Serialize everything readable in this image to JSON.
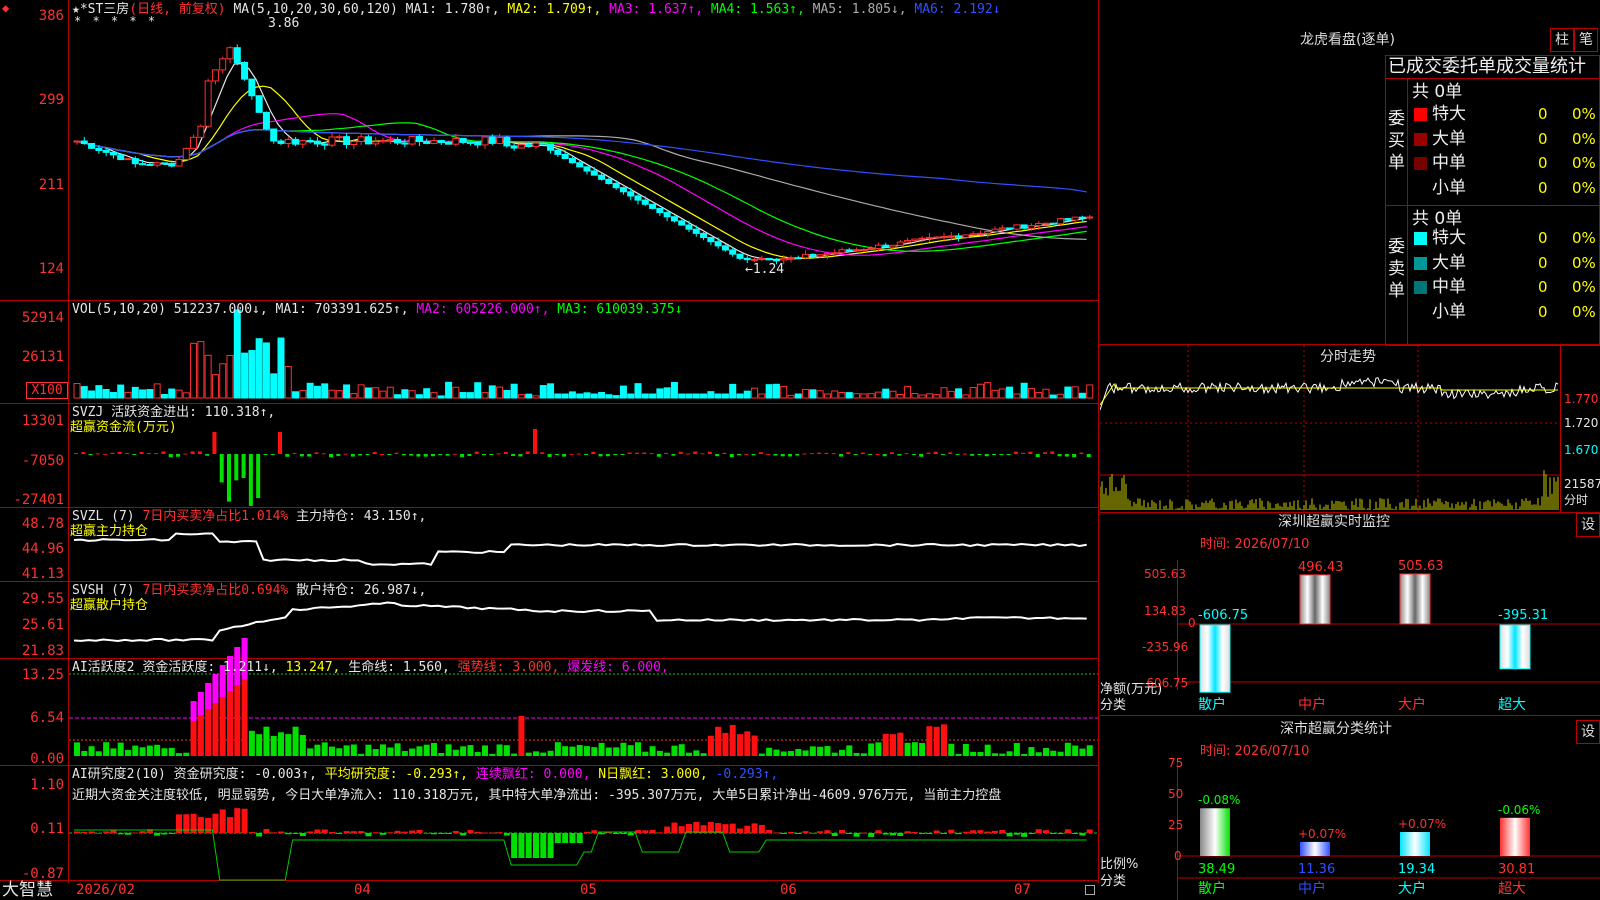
{
  "window": {
    "control_glyph": "◆"
  },
  "main": {
    "stock_name": "★*ST三房",
    "period": "(日线, 前复权)",
    "top_marks": "* *  * * *",
    "ma_header": "MA(5,10,20,30,60,120)",
    "ma": [
      {
        "label": "MA1: 1.780↑,",
        "color": "#e6e6e6"
      },
      {
        "label": "MA2: 1.709↑,",
        "color": "#ffff00"
      },
      {
        "label": "MA3: 1.637↑,",
        "color": "#ff00ff"
      },
      {
        "label": "MA4: 1.563↑,",
        "color": "#00ff00"
      },
      {
        "label": "MA5: 1.805↓,",
        "color": "#aaaaaa"
      },
      {
        "label": "MA6: 2.192↓",
        "color": "#3050ff"
      }
    ],
    "high_label": "3.86",
    "low_label": "←1.24",
    "yaxis": [
      "386",
      "299",
      "211",
      "124"
    ]
  },
  "vol": {
    "header": "VOL(5,10,20)",
    "value": "512237.000↓,",
    "ma1": "MA1: 703391.625↑,",
    "ma2": "MA2: 605226.000↑,",
    "ma3": "MA3: 610039.375↓",
    "yaxis": [
      "52914",
      "26131"
    ],
    "unit": "X100"
  },
  "svzj": {
    "header": "SVZJ",
    "line1": "活跃资金进出: 110.318↑,",
    "line2": "超赢资金流(万元)",
    "yaxis": [
      "13301",
      "-7050",
      "-27401"
    ]
  },
  "svzl": {
    "header": "SVZL (7)",
    "net": "7日内买卖净占比1.014%",
    "hold": "主力持仓: 43.150↑,",
    "line2": "超赢主力持仓",
    "yaxis": [
      "48.78",
      "44.96",
      "41.13"
    ]
  },
  "svsh": {
    "header": "SVSH (7)",
    "net": "7日内买卖净占比0.694%",
    "hold": "散户持仓: 26.987↓,",
    "line2": "超赢散户持仓",
    "yaxis": [
      "29.55",
      "25.61",
      "21.83"
    ]
  },
  "ai_active": {
    "header": "AI活跃度2",
    "v1": "资金活跃度: 1.211↓,",
    "v2": "13.247,",
    "v3": "生命线: 1.560,",
    "v4": "强势线: 3.000,",
    "v5": "爆发线: 6.000,",
    "yaxis": [
      "13.25",
      "6.54",
      "0.00"
    ]
  },
  "ai_research": {
    "header": "AI研究度2(10)",
    "v1": "资金研究度: -0.003↑,",
    "v2": "平均研究度: -0.293↑,",
    "v3": "连续飘红: 0.000,",
    "v4": "N日飘红: 3.000,",
    "v5": "-0.293↑,",
    "comment": "近期大资金关注度较低, 明显弱势, 今日大单净流入: 110.318万元, 其中特大单净流出: -395.307万元, 大单5日累计净出-4609.976万元, 当前主力控盘",
    "yaxis": [
      "1.10",
      "0.11",
      "-0.87"
    ]
  },
  "xaxis": {
    "brand": "大智慧",
    "labels": [
      "2026/02",
      "04",
      "05",
      "06",
      "07"
    ]
  },
  "dragon": {
    "title": "龙虎看盘(逐单)",
    "btn_bar": "柱",
    "btn_pen": "笔",
    "subtitle": "已成交委托单成交量统计",
    "buy_label": "委买单",
    "sell_label": "委卖单",
    "buy_total": "共 0单",
    "sell_total": "共 0单",
    "buy_rows": [
      {
        "name": "特大",
        "count": "0",
        "pct": "0%",
        "color": "#ff0000"
      },
      {
        "name": "大单",
        "count": "0",
        "pct": "0%",
        "color": "#990000"
      },
      {
        "name": "中单",
        "count": "0",
        "pct": "0%",
        "color": "#770000"
      },
      {
        "name": "小单",
        "count": "0",
        "pct": "0%",
        "color": "#000000"
      }
    ],
    "sell_rows": [
      {
        "name": "特大",
        "count": "0",
        "pct": "0%",
        "color": "#00ffff"
      },
      {
        "name": "大单",
        "count": "0",
        "pct": "0%",
        "color": "#009999"
      },
      {
        "name": "中单",
        "count": "0",
        "pct": "0%",
        "color": "#007777"
      },
      {
        "name": "小单",
        "count": "0",
        "pct": "0%",
        "color": "#000000"
      }
    ]
  },
  "intraday": {
    "title": "分时走势",
    "yaxis": [
      "1.770",
      "1.720",
      "1.670"
    ],
    "vol_label": "21587",
    "unit": "分时"
  },
  "monitor": {
    "title": "深圳超赢实时监控",
    "btn": "设",
    "time": "时间: 2026/07/10",
    "yaxis": [
      "505.63",
      "134.83",
      "0",
      "-235.96",
      "-606.75"
    ],
    "ylabel1": "净额(万元)",
    "ylabel2": "分类",
    "bars": [
      {
        "name": "散户",
        "value": -606.75,
        "label": "-606.75",
        "label_color": "#00ffff"
      },
      {
        "name": "中户",
        "value": 496.43,
        "label": "496.43",
        "label_color": "#ff3030"
      },
      {
        "name": "大户",
        "value": 505.63,
        "label": "505.63",
        "label_color": "#ff3030"
      },
      {
        "name": "超大",
        "value": -395.31,
        "label": "-395.31",
        "label_color": "#00ffff"
      }
    ]
  },
  "classify": {
    "title": "深市超赢分类统计",
    "btn": "设",
    "time": "时间: 2026/07/10",
    "yaxis": [
      "75",
      "50",
      "25",
      "0"
    ],
    "ylabel1": "比例%",
    "ylabel2": "分类",
    "bars": [
      {
        "name": "散户",
        "value": 38.49,
        "label": "38.49",
        "change": "-0.08%",
        "change_color": "#00ff00",
        "label_color": "#00ff00"
      },
      {
        "name": "中户",
        "value": 11.36,
        "label": "11.36",
        "change": "+0.07%",
        "change_color": "#ff3030",
        "label_color": "#3050ff"
      },
      {
        "name": "大户",
        "value": 19.34,
        "label": "19.34",
        "change": "+0.07%",
        "change_color": "#ff3030",
        "label_color": "#00ffff"
      },
      {
        "name": "超大",
        "value": 30.81,
        "label": "30.81",
        "change": "-0.06%",
        "change_color": "#00ff00",
        "label_color": "#ff3030"
      }
    ]
  }
}
